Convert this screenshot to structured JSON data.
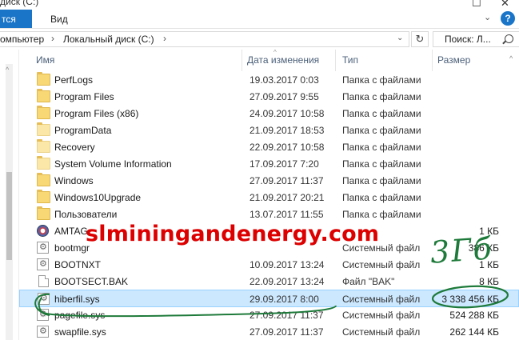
{
  "window": {
    "title": "диск (C:)",
    "maximize_glyph": "☐",
    "close_glyph": "✕"
  },
  "ribbon": {
    "tab_share_label": "тся",
    "tab_view_label": "Вид",
    "expand_glyph": "⌄",
    "help_glyph": "?"
  },
  "address": {
    "crumbs": [
      "омпьютер",
      "Локальный диск (C:)"
    ],
    "separator": "›",
    "dropdown_glyph": "⌄",
    "refresh_glyph": "↻"
  },
  "search": {
    "placeholder": "Поиск: Л..."
  },
  "columns": {
    "name": "Имя",
    "date": "Дата изменения",
    "type": "Тип",
    "size": "Размер"
  },
  "sort_glyph": "^",
  "scroll_glyph": "^",
  "rows": [
    {
      "name": "PerfLogs",
      "date": "19.03.2017 0:03",
      "type": "Папка с файлами",
      "size": "",
      "icon": "folder-icon"
    },
    {
      "name": "Program Files",
      "date": "27.09.2017 9:55",
      "type": "Папка с файлами",
      "size": "",
      "icon": "folder-icon"
    },
    {
      "name": "Program Files (x86)",
      "date": "24.09.2017 10:58",
      "type": "Папка с файлами",
      "size": "",
      "icon": "folder-icon"
    },
    {
      "name": "ProgramData",
      "date": "21.09.2017 18:53",
      "type": "Папка с файлами",
      "size": "",
      "icon": "hidden-folder-icon"
    },
    {
      "name": "Recovery",
      "date": "22.09.2017 10:58",
      "type": "Папка с файлами",
      "size": "",
      "icon": "hidden-folder-icon"
    },
    {
      "name": "System Volume Information",
      "date": "17.09.2017 7:20",
      "type": "Папка с файлами",
      "size": "",
      "icon": "hidden-folder-icon"
    },
    {
      "name": "Windows",
      "date": "27.09.2017 11:37",
      "type": "Папка с файлами",
      "size": "",
      "icon": "folder-icon"
    },
    {
      "name": "Windows10Upgrade",
      "date": "21.09.2017 20:21",
      "type": "Папка с файлами",
      "size": "",
      "icon": "folder-icon"
    },
    {
      "name": "Пользователи",
      "date": "13.07.2017 11:55",
      "type": "Папка с файлами",
      "size": "",
      "icon": "folder-icon"
    },
    {
      "name": "AMTAG",
      "date": "",
      "type": "",
      "size": "1 КБ",
      "icon": "amtag-icon"
    },
    {
      "name": "bootmgr",
      "date": "",
      "type": "Системный файл",
      "size": "386 КБ",
      "icon": "system-file-icon"
    },
    {
      "name": "BOOTNXT",
      "date": "10.09.2017 13:24",
      "type": "Системный файл",
      "size": "1 КБ",
      "icon": "system-file-icon"
    },
    {
      "name": "BOOTSECT.BAK",
      "date": "22.09.2017 13:24",
      "type": "Файл \"BAK\"",
      "size": "8 КБ",
      "icon": "file-icon"
    },
    {
      "name": "hiberfil.sys",
      "date": "29.09.2017 8:00",
      "type": "Системный файл",
      "size": "3 338 456 КБ",
      "icon": "system-file-icon",
      "selected": true
    },
    {
      "name": "pagefile.sys",
      "date": "27.09.2017 11:37",
      "type": "Системный файл",
      "size": "524 288 КБ",
      "icon": "system-file-icon"
    },
    {
      "name": "swapfile.sys",
      "date": "27.09.2017 11:37",
      "type": "Системный файл",
      "size": "262 144 КБ",
      "icon": "system-file-icon"
    }
  ],
  "annotation": {
    "handwritten": "3Гб",
    "color": "#1e7a3a"
  },
  "watermark": {
    "text": "slminingandenergy.com",
    "color": "#dd0000"
  }
}
